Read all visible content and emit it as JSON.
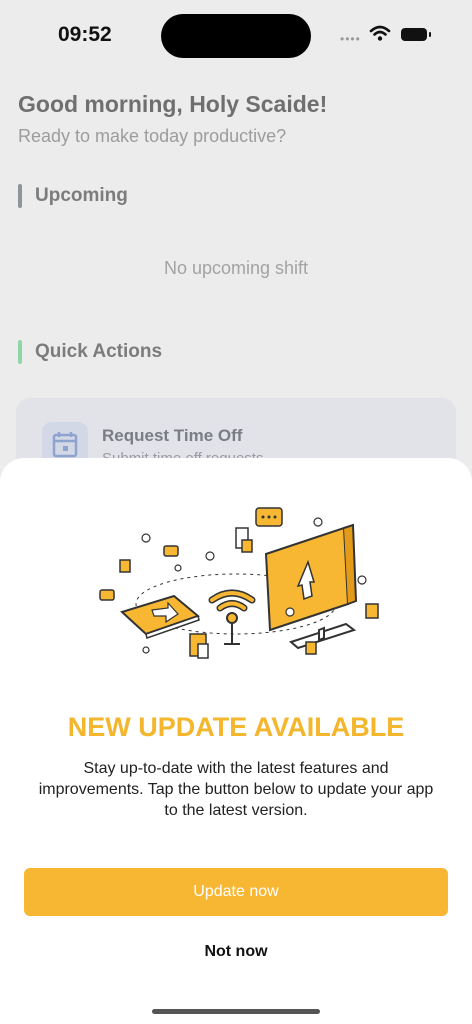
{
  "status": {
    "time": "09:52",
    "icons": [
      "signal-dots-icon",
      "wifi-icon",
      "battery-icon"
    ]
  },
  "home": {
    "greeting": "Good morning, Holy Scaide!",
    "subtitle": "Ready to make today productive?",
    "upcoming_title": "Upcoming",
    "upcoming_empty": "No upcoming shift",
    "quick_actions_title": "Quick Actions",
    "action": {
      "title": "Request Time Off",
      "subtitle": "Submit time off requests",
      "icon": "calendar-icon"
    }
  },
  "modal": {
    "title": "NEW UPDATE AVAILABLE",
    "description": "Stay up-to-date with the latest features and improvements. Tap the button below to update your app to the latest version.",
    "primary_button": "Update now",
    "secondary_button": "Not now",
    "illustration": "update-illustration"
  },
  "colors": {
    "accent": "#F7B733",
    "headline": "#F3B62C",
    "upcoming_bar": "#8F939C",
    "quick_actions_bar": "#8FD6A4"
  }
}
